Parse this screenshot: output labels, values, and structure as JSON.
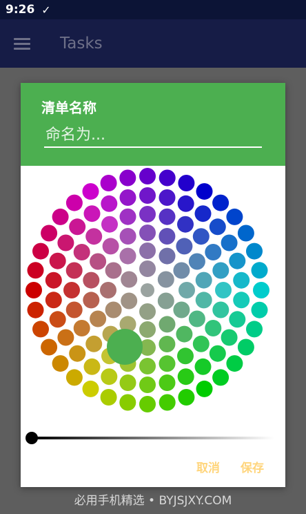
{
  "status": {
    "time": "9:26",
    "check_icon": "✓"
  },
  "appbar": {
    "title": "Tasks",
    "menu_icon": "hamburger-menu-icon"
  },
  "dialog": {
    "title": "清单名称",
    "input_placeholder": "命名为...",
    "input_value": "",
    "cancel_label": "取消",
    "save_label": "保存",
    "selected_color": "#4caf50",
    "brightness_level": 0
  },
  "colors": {
    "header": "#4caf50",
    "button_text": "#ffd57c",
    "appbar": "#161c46"
  },
  "watermark": "必用手机精选 • BYJSJXY.COM"
}
